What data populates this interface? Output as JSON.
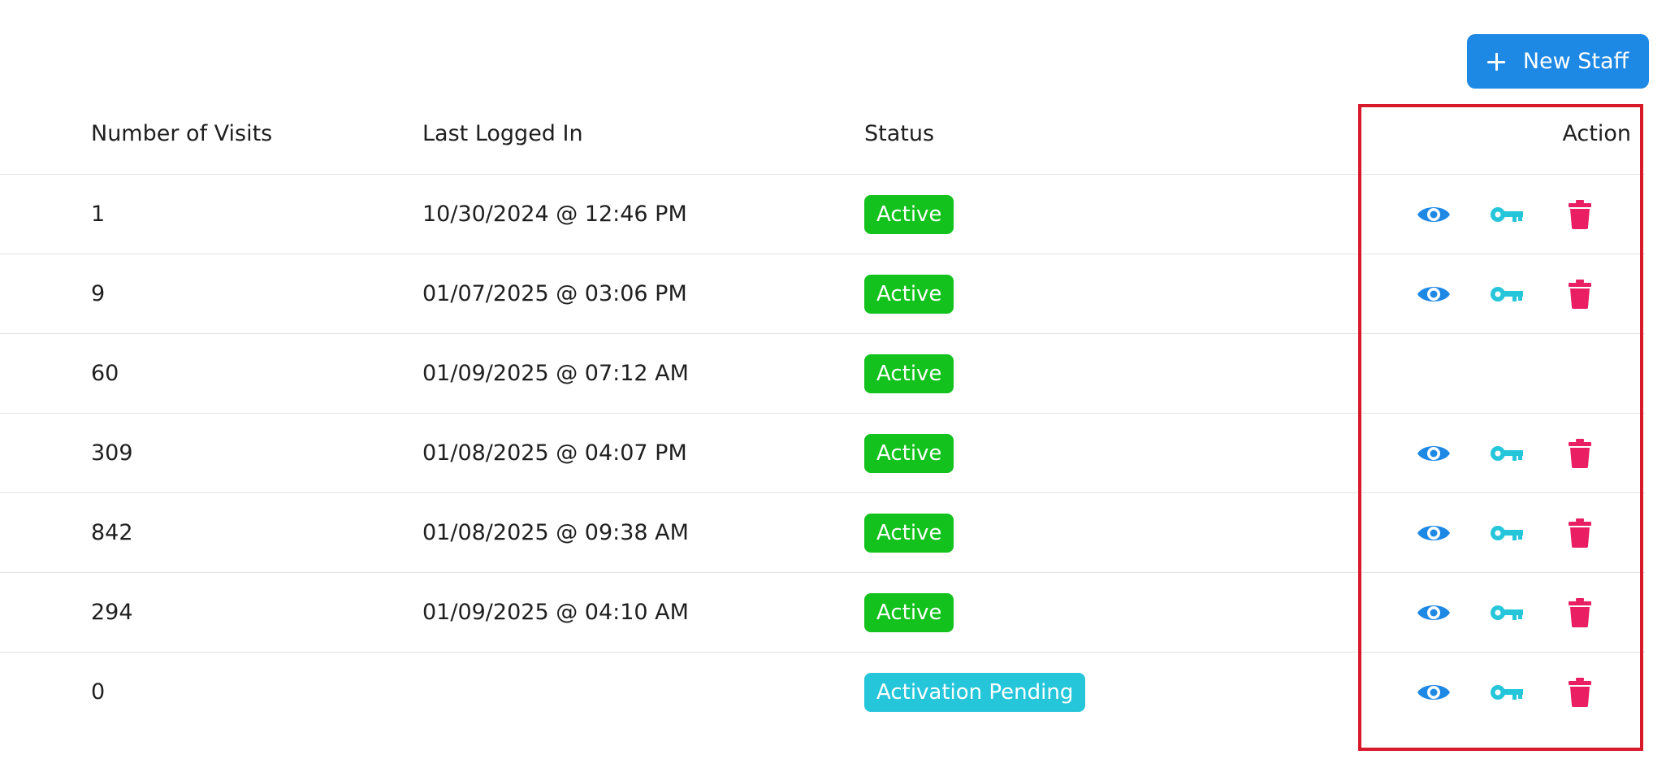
{
  "toolbar": {
    "new_staff_label": "New Staff",
    "new_staff_icon": "plus-icon"
  },
  "table": {
    "columns": {
      "visits": "Number of Visits",
      "last_logged_in": "Last Logged In",
      "status": "Status",
      "action": "Action"
    },
    "rows": [
      {
        "visits": "1",
        "last_logged_in": "10/30/2024 @ 12:46 PM",
        "status": "Active",
        "status_color": "#14c21e",
        "actions": true
      },
      {
        "visits": "9",
        "last_logged_in": "01/07/2025 @ 03:06 PM",
        "status": "Active",
        "status_color": "#14c21e",
        "actions": true
      },
      {
        "visits": "60",
        "last_logged_in": "01/09/2025 @ 07:12 AM",
        "status": "Active",
        "status_color": "#14c21e",
        "actions": false
      },
      {
        "visits": "309",
        "last_logged_in": "01/08/2025 @ 04:07 PM",
        "status": "Active",
        "status_color": "#14c21e",
        "actions": true
      },
      {
        "visits": "842",
        "last_logged_in": "01/08/2025 @ 09:38 AM",
        "status": "Active",
        "status_color": "#14c21e",
        "actions": true
      },
      {
        "visits": "294",
        "last_logged_in": "01/09/2025 @ 04:10 AM",
        "status": "Active",
        "status_color": "#14c21e",
        "actions": true
      },
      {
        "visits": "0",
        "last_logged_in": "",
        "status": "Activation Pending",
        "status_color": "#26c6da",
        "actions": true
      }
    ]
  },
  "action_icons": {
    "view": {
      "icon": "eye-icon",
      "color": "#1e88e5"
    },
    "password": {
      "icon": "key-icon",
      "color": "#26c6da"
    },
    "delete": {
      "icon": "trash-icon",
      "color": "#e91e63"
    }
  },
  "colors": {
    "primary": "#1e88e5",
    "highlight_border": "#d7192a"
  }
}
